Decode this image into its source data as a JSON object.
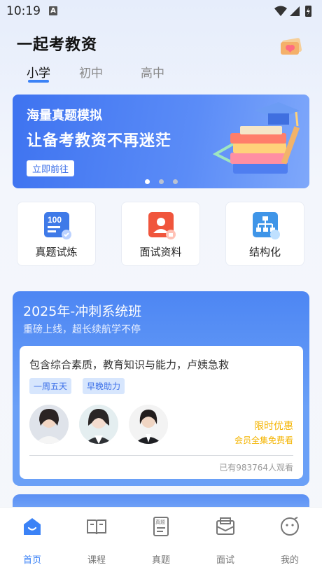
{
  "status_bar": {
    "time": "10:19",
    "notification_badge": "A"
  },
  "header": {
    "title": "一起考教资"
  },
  "tabs": [
    {
      "label": "小学",
      "active": true
    },
    {
      "label": "初中",
      "active": false
    },
    {
      "label": "高中",
      "active": false
    }
  ],
  "banner": {
    "line1": "海量真题模拟",
    "line2": "让备考教资不再迷茫",
    "button": "立即前往",
    "dots": 3,
    "active_dot": 0
  },
  "quick_entries": [
    {
      "label": "真题试炼",
      "icon": "score-100-icon",
      "icon_text": "100"
    },
    {
      "label": "面试资料",
      "icon": "interview-icon"
    },
    {
      "label": "结构化",
      "icon": "structure-icon"
    }
  ],
  "course": {
    "title": "2025年-冲刺系统班",
    "subtitle": "重磅上线，超长续航学不停",
    "description": "包含综合素质，教育知识与能力，卢姨急救",
    "tags": [
      "一周五天",
      "早晚助力"
    ],
    "promo_title": "限时优惠",
    "promo_sub": "会员全集免费看",
    "viewers": "已有983764人观看"
  },
  "bottom_nav": [
    {
      "label": "首页",
      "icon": "home-icon",
      "active": true
    },
    {
      "label": "课程",
      "icon": "book-icon",
      "active": false
    },
    {
      "label": "真题",
      "icon": "exam-paper-icon",
      "icon_text": "真题",
      "active": false
    },
    {
      "label": "面试",
      "icon": "envelope-icon",
      "active": false
    },
    {
      "label": "我的",
      "icon": "profile-face-icon",
      "active": false
    }
  ],
  "colors": {
    "accent": "#3b82f6",
    "promo": "#f4b400",
    "banner": "#3e73f0"
  }
}
